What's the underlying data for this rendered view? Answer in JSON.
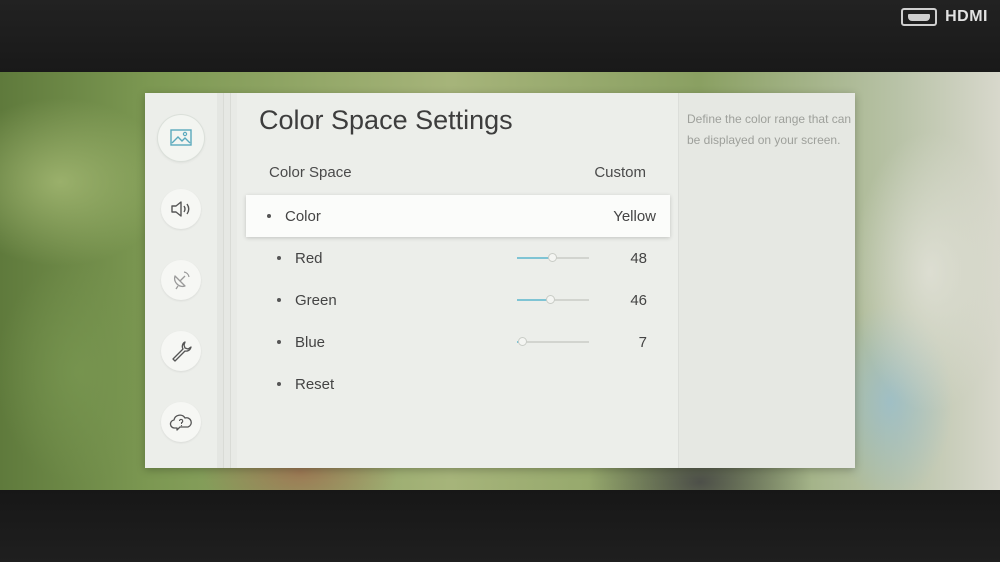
{
  "source": {
    "label": "HDMI",
    "icon": "hdmi-port-icon"
  },
  "sidebar": {
    "items": [
      {
        "name": "picture",
        "icon": "picture-icon",
        "active": true
      },
      {
        "name": "sound",
        "icon": "speaker-icon",
        "active": false
      },
      {
        "name": "broadcasting",
        "icon": "satellite-icon",
        "active": false
      },
      {
        "name": "general",
        "icon": "wrench-icon",
        "active": false
      },
      {
        "name": "support",
        "icon": "support-cloud-icon",
        "active": false
      }
    ]
  },
  "menu": {
    "title": "Color Space Settings",
    "color_space": {
      "label": "Color Space",
      "value": "Custom"
    },
    "color": {
      "label": "Color",
      "value": "Yellow"
    },
    "channels": [
      {
        "label": "Red",
        "value": "48",
        "level": 48
      },
      {
        "label": "Green",
        "value": "46",
        "level": 46
      },
      {
        "label": "Blue",
        "value": "7",
        "level": 7
      }
    ],
    "reset": {
      "label": "Reset"
    }
  },
  "description": "Define the color range that can be displayed on your screen.",
  "colors": {
    "accent": "#7fc4d4",
    "panel": "#eceeea",
    "text": "#444444"
  }
}
